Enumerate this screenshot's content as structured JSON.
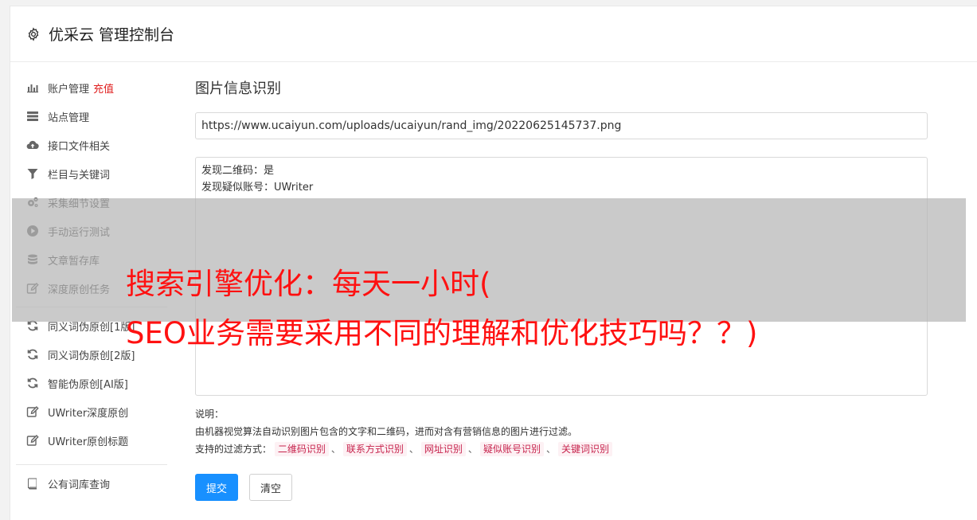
{
  "header": {
    "title": "优采云 管理控制台",
    "icon": "gear-icon"
  },
  "sidebar": {
    "group1": [
      {
        "label": "账户管理",
        "extra": "充值",
        "icon": "bar-chart-icon"
      },
      {
        "label": "站点管理",
        "icon": "server-icon"
      },
      {
        "label": "接口文件相关",
        "icon": "cloud-upload-icon"
      },
      {
        "label": "栏目与关键词",
        "icon": "filter-icon"
      },
      {
        "label": "采集细节设置",
        "icon": "cogs-icon"
      },
      {
        "label": "手动运行测试",
        "icon": "play-circle-icon"
      },
      {
        "label": "文章暂存库",
        "icon": "database-icon"
      },
      {
        "label": "深度原创任务",
        "icon": "edit-icon"
      }
    ],
    "group2": [
      {
        "label": "同义词伪原创[1版]",
        "icon": "refresh-icon"
      },
      {
        "label": "同义词伪原创[2版]",
        "icon": "refresh-icon"
      },
      {
        "label": "智能伪原创[AI版]",
        "icon": "refresh-icon"
      },
      {
        "label": "UWriter深度原创",
        "icon": "edit-icon"
      },
      {
        "label": "UWriter原创标题",
        "icon": "edit-icon"
      }
    ],
    "group3": [
      {
        "label": "公有词库查询",
        "icon": "book-icon"
      }
    ]
  },
  "main": {
    "title": "图片信息识别",
    "url_value": "https://www.ucaiyun.com/uploads/ucaiyun/rand_img/20220625145737.png",
    "result_lines": [
      "发现二维码：是",
      "发现疑似账号：UWriter"
    ],
    "explain_label": "说明：",
    "explain_text": "由机器视觉算法自动识别图片包含的文字和二维码，进而对含有营销信息的图片进行过滤。",
    "filter_label": "支持的过滤方式：",
    "filter_tags": [
      "二维码识别",
      "联系方式识别",
      "网址识别",
      "疑似账号识别",
      "关键词识别"
    ],
    "submit_label": "提交",
    "clear_label": "清空"
  },
  "overlay": {
    "line1": "搜索引擎优化：每天一小时(",
    "line2": "SEO业务需要采用不同的理解和优化技巧吗？？)"
  },
  "colors": {
    "accent": "#1890ff",
    "recharge": "#e02020",
    "overlay_text": "#ff1111",
    "tag_text": "#c7254e"
  }
}
